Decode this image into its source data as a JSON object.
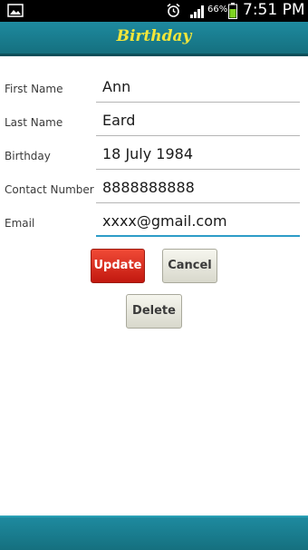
{
  "status_bar": {
    "battery_percent": "66%",
    "time": "7:51 PM",
    "icons": [
      "gallery-icon",
      "alarm-icon",
      "signal-icon",
      "battery-icon"
    ]
  },
  "app": {
    "title": "Birthday"
  },
  "form": {
    "fields": [
      {
        "label": "First Name",
        "value": "Ann"
      },
      {
        "label": "Last Name",
        "value": "Eard"
      },
      {
        "label": "Birthday",
        "value": "18 July 1984"
      },
      {
        "label": "Contact Number",
        "value": "8888888888"
      },
      {
        "label": "Email",
        "value": "xxxx@gmail.com",
        "focused": true
      }
    ]
  },
  "buttons": {
    "update": "Update",
    "cancel": "Cancel",
    "delete": "Delete"
  },
  "colors": {
    "title_bar": "#1a7f92",
    "title_text": "#f2e63a",
    "update_button": "#e0301f",
    "focus_underline": "#2d9cc8"
  }
}
